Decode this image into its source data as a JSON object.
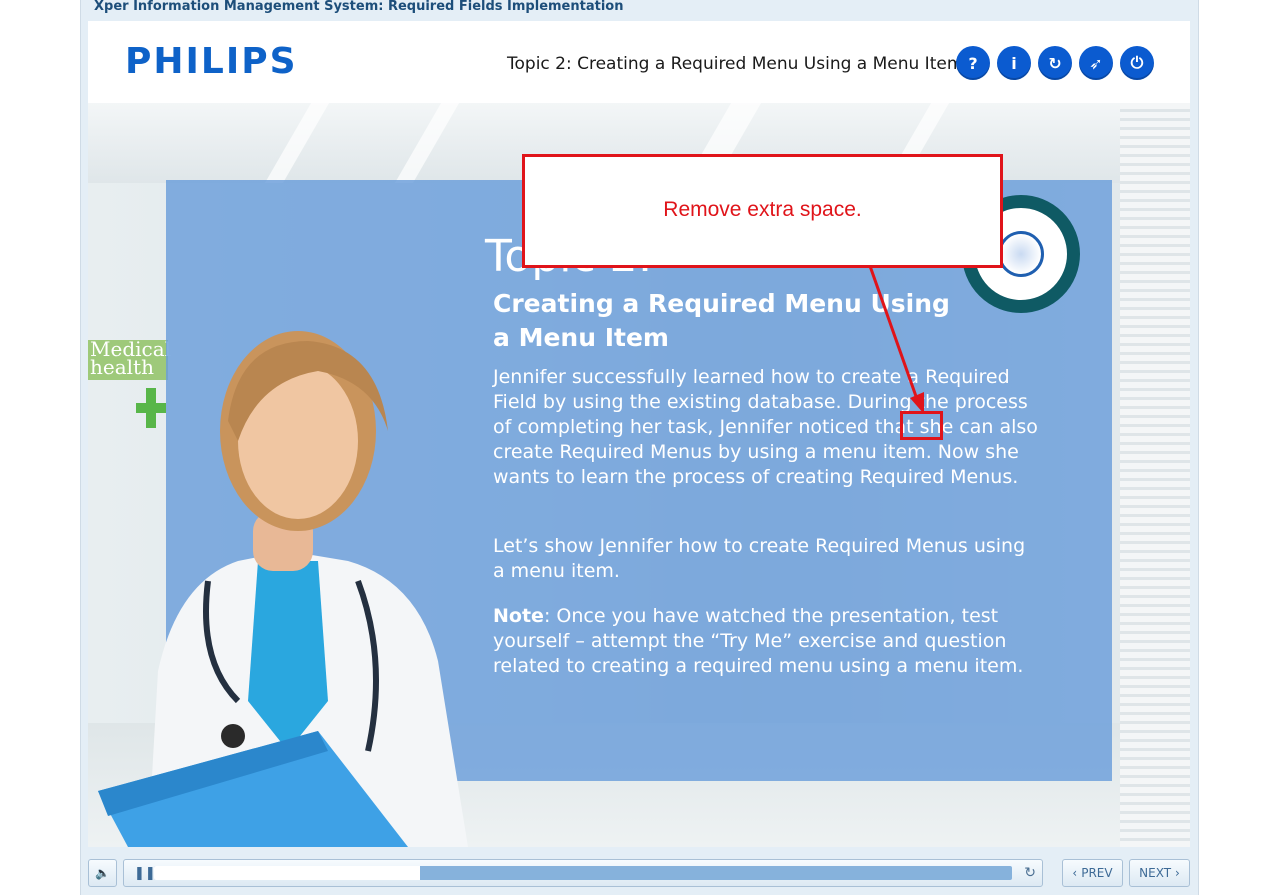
{
  "app": {
    "title": "Xper Information Management System: Required Fields Implementation"
  },
  "header": {
    "logo": "PHILIPS",
    "topic": "Topic 2: Creating a Required Menu Using a Menu Item",
    "buttons": [
      {
        "icon": "help-icon",
        "glyph": "?"
      },
      {
        "icon": "info-icon",
        "glyph": "i"
      },
      {
        "icon": "replay-icon",
        "glyph": "↻"
      },
      {
        "icon": "compass-icon",
        "glyph": "➶"
      },
      {
        "icon": "power-icon",
        "glyph": "⏻"
      }
    ]
  },
  "slide": {
    "topic_label": "Topic 2:",
    "subtitle": "Creating a Required Menu Using a Menu Item",
    "paragraph1": "Jennifer successfully learned how to create a Required Field by using the existing database. During the process of completing her task, Jennifer  noticed that she can also create Required Menus by using a menu item. Now she wants to learn the process of creating Required Menus.",
    "paragraph2": "Let’s show Jennifer how to create Required Menus using a menu item.",
    "note_label": "Note",
    "note_text": ": Once you have watched the presentation, test yourself – attempt the “Try Me” exercise and question related to creating a required menu using a menu item.",
    "sign_text": "Medical health"
  },
  "annotation": {
    "callout": "Remove extra space.",
    "color": "#e0141a"
  },
  "controls": {
    "progress": 0.31,
    "prev_label": "PREV",
    "next_label": "NEXT"
  },
  "colors": {
    "accent": "#0b5bd0",
    "panel": "#6a9eda"
  }
}
